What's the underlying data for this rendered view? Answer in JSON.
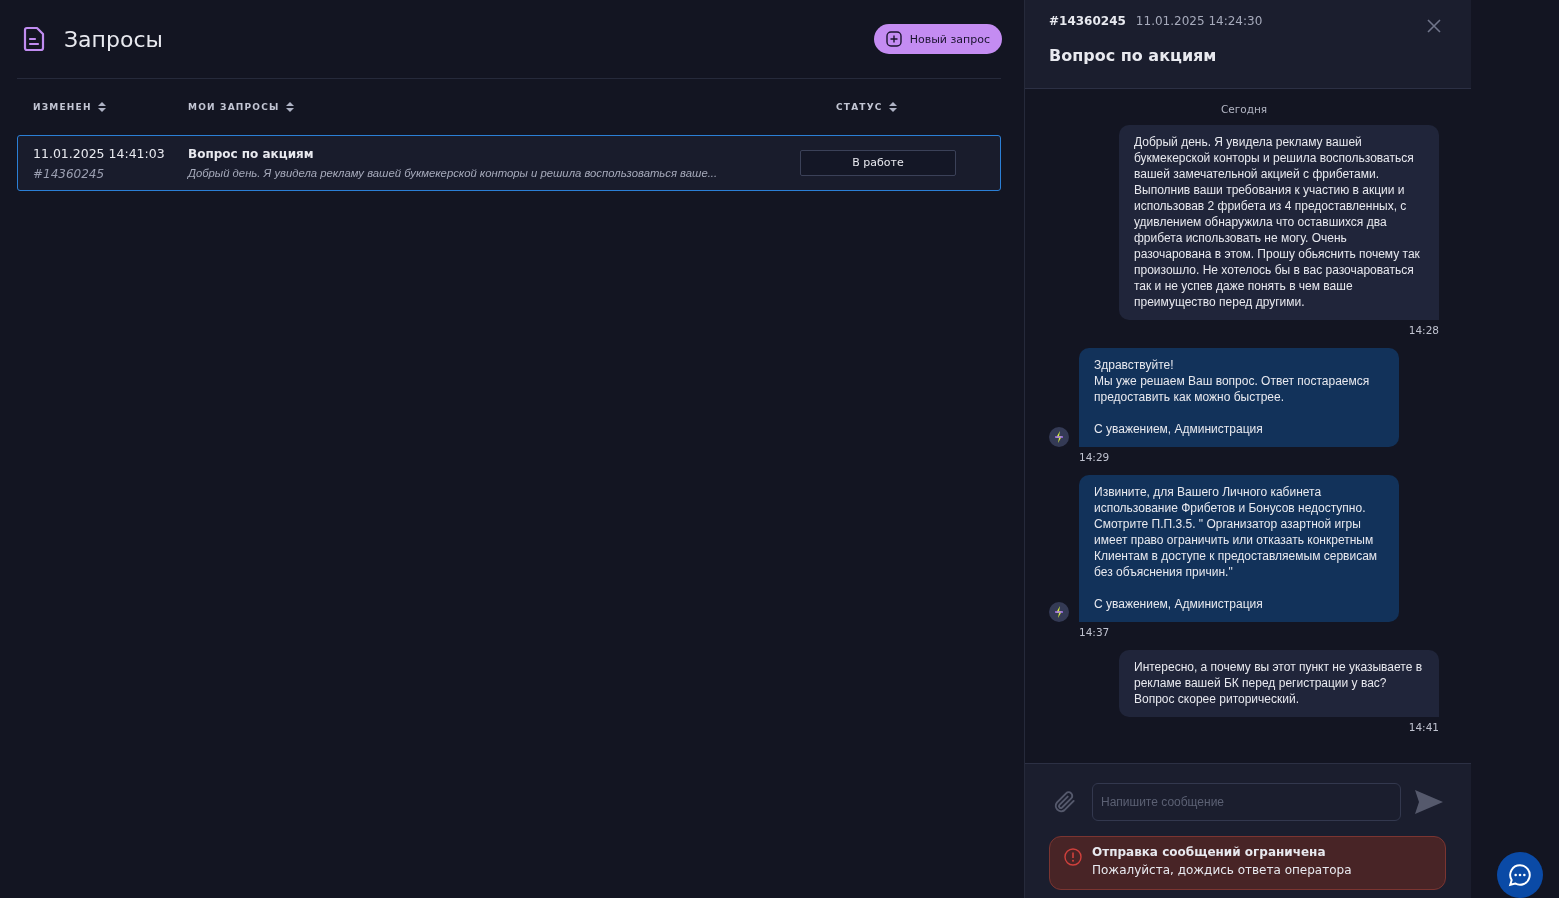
{
  "page": {
    "title": "Запросы",
    "new_request_button": "Новый запрос"
  },
  "table": {
    "columns": [
      "ИЗМЕНЕН",
      "МОИ ЗАПРОСЫ",
      "СТАТУС"
    ],
    "rows": [
      {
        "selected": true,
        "date": "11.01.2025 14:41:03",
        "number": "#14360245",
        "subject": "Вопрос по акциям",
        "preview": "Добрый день. Я увидела рекламу вашей букмекерской конторы и решила воспользоваться ваше...",
        "status": "В работе"
      }
    ]
  },
  "chat": {
    "number": "#14360245",
    "date": "11.01.2025 14:24:30",
    "title": "Вопрос по акциям",
    "day_label": "Сегодня",
    "messages": [
      {
        "kind": "user",
        "text": "Добрый день. Я увидела рекламу вашей букмекерской конторы и решила воспользоваться вашей замечательной акцией с фрибетами. Выполнив ваши требования к участию в акции и использовав 2 фрибета из 4 предоставленных, с удивлением обнаружила что оставшихся два фрибета использовать не могу. Очень разочарована в этом. Прошу обьяснить почему так произошло. Не хотелось бы в вас разочароваться так и не успев даже понять в чем ваше преимущество перед другими.",
        "time": "14:28"
      },
      {
        "kind": "operator",
        "text": "Здравствуйте!\nМы уже решаем Ваш вопрос. Ответ постараемся предоставить как можно быстрее.\n\nС уважением, Администрация",
        "time": "14:29"
      },
      {
        "kind": "operator",
        "text": "Извините, для Вашего Личного кабинета использование Фрибетов и Бонусов недоступно. Смотрите П.П.3.5. \" Организатор азартной игры имеет право ограничить или отказать конкретным Клиентам в доступе к предоставляемым сервисам без объяснения причин.\"\n\nС уважением, Администрация",
        "time": "14:37"
      },
      {
        "kind": "user",
        "text": "Интересно, а почему вы этот пункт не указываете в рекламе вашей БК перед регистрации у вас? Вопрос скорее риторический.",
        "time": "14:41"
      }
    ],
    "input": {
      "placeholder": "Напишите сообщение"
    },
    "alert": {
      "title": "Отправка сообщений ограничена",
      "text": "Пожалуйста, дождись ответа оператора"
    }
  }
}
